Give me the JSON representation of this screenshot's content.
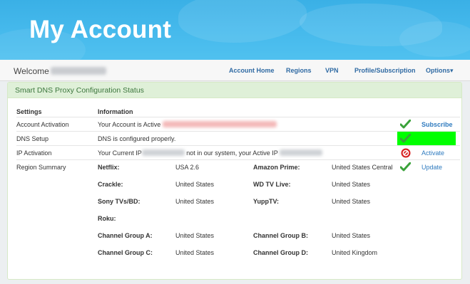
{
  "banner": {
    "title": "My Account"
  },
  "navbar": {
    "welcome": "Welcome",
    "links": [
      "Account Home",
      "Regions",
      "VPN",
      "Profile/Subscription",
      "Options▾"
    ]
  },
  "panel": {
    "title": "Smart DNS Proxy Configuration Status"
  },
  "table": {
    "headers": [
      "Settings",
      "Information"
    ],
    "rows": [
      {
        "setting": "Account Activation",
        "info": "Your Account is Active",
        "action": "Subscribe"
      },
      {
        "setting": "DNS Setup",
        "info": "DNS is configured properly."
      },
      {
        "setting": "IP Activation",
        "info_a": "Your Current IP",
        "info_b": "not in our system, your Active IP",
        "action": "Activate"
      },
      {
        "setting": "Region Summary",
        "action": "Update"
      }
    ]
  },
  "regions": [
    {
      "name": "Netflix:",
      "value": "USA 2.6"
    },
    {
      "name": "Amazon Prime:",
      "value": "United States Central"
    },
    {
      "name": "Crackle:",
      "value": "United States"
    },
    {
      "name": "WD TV Live:",
      "value": "United States"
    },
    {
      "name": "Sony TVs/BD:",
      "value": "United States"
    },
    {
      "name": "YuppTV:",
      "value": "United States"
    },
    {
      "name": "Roku:",
      "value": ""
    },
    {
      "name": "Channel Group A:",
      "value": "United States"
    },
    {
      "name": "Channel Group B:",
      "value": "United States"
    },
    {
      "name": "Channel Group C:",
      "value": "United States"
    },
    {
      "name": "Channel Group D:",
      "value": "United Kingdom"
    }
  ],
  "colors": {
    "banner": "#45b9ec",
    "panel_head": "#dff0d8",
    "link": "#2f7bbf",
    "highlight": "#00ff00",
    "ok": "#3aa23a",
    "error": "#d61f1f"
  }
}
